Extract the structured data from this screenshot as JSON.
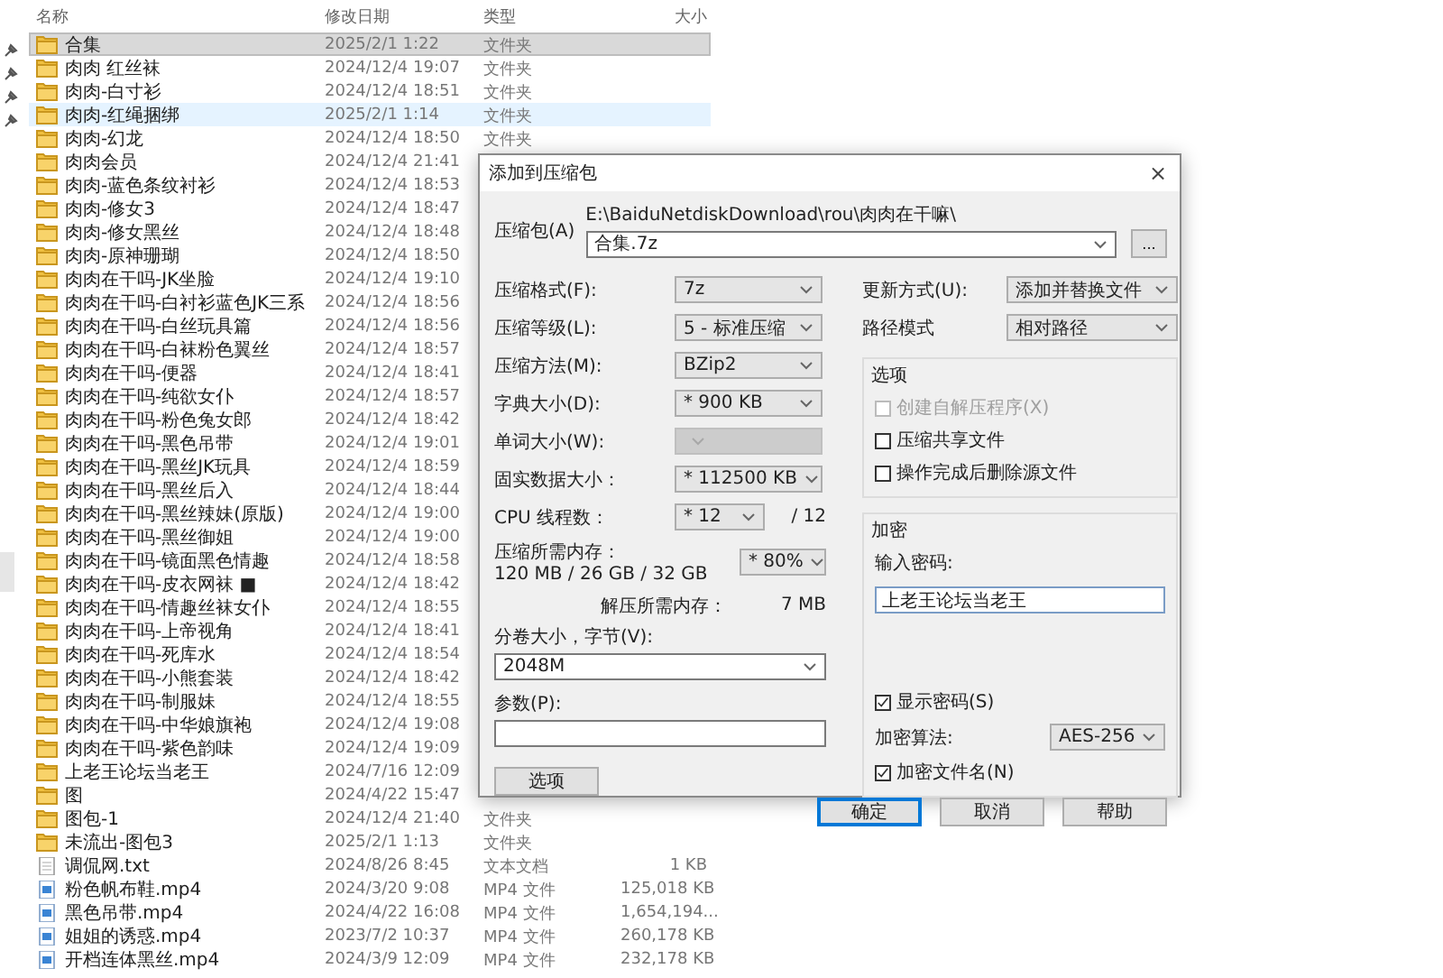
{
  "explorer": {
    "columns": [
      "名称",
      "修改日期",
      "类型",
      "大小"
    ],
    "items": [
      {
        "name": "合集",
        "kind": "folder",
        "modified": "2025/2/1 1:22",
        "type": "文件夹",
        "selected": true,
        "hovered": false
      },
      {
        "name": "肉肉 红丝袜",
        "kind": "folder",
        "modified": "2024/12/4 19:07",
        "type": "文件夹",
        "selected": false,
        "hovered": false
      },
      {
        "name": "肉肉-白寸衫",
        "kind": "folder",
        "modified": "2024/12/4 18:51",
        "type": "文件夹",
        "selected": false,
        "hovered": false
      },
      {
        "name": "肉肉-红绳捆绑",
        "kind": "folder",
        "modified": "2025/2/1 1:14",
        "type": "文件夹",
        "selected": false,
        "hovered": true
      },
      {
        "name": "肉肉-幻龙",
        "kind": "folder",
        "modified": "2024/12/4 18:50",
        "type": "文件夹",
        "selected": false,
        "hovered": false
      },
      {
        "name": "肉肉会员",
        "kind": "folder",
        "modified": "2024/12/4 21:41",
        "selected": false,
        "hovered": false
      },
      {
        "name": "肉肉-蓝色条纹衬衫",
        "kind": "folder",
        "modified": "2024/12/4 18:53",
        "selected": false,
        "hovered": false
      },
      {
        "name": "肉肉-修女3",
        "kind": "folder",
        "modified": "2024/12/4 18:47",
        "selected": false,
        "hovered": false
      },
      {
        "name": "肉肉-修女黑丝",
        "kind": "folder",
        "modified": "2024/12/4 18:48",
        "selected": false,
        "hovered": false
      },
      {
        "name": "肉肉-原神珊瑚",
        "kind": "folder",
        "modified": "2024/12/4 18:50",
        "selected": false,
        "hovered": false
      },
      {
        "name": "肉肉在干吗-JK坐脸",
        "kind": "folder",
        "modified": "2024/12/4 19:10",
        "selected": false,
        "hovered": false
      },
      {
        "name": "肉肉在干吗-白衬衫蓝色JK三系",
        "kind": "folder",
        "modified": "2024/12/4 18:56",
        "selected": false,
        "hovered": false
      },
      {
        "name": "肉肉在干吗-白丝玩具篇",
        "kind": "folder",
        "modified": "2024/12/4 18:56",
        "selected": false,
        "hovered": false
      },
      {
        "name": "肉肉在干吗-白袜粉色翼丝",
        "kind": "folder",
        "modified": "2024/12/4 18:57",
        "selected": false,
        "hovered": false
      },
      {
        "name": "肉肉在干吗-便器",
        "kind": "folder",
        "modified": "2024/12/4 18:41",
        "selected": false,
        "hovered": false
      },
      {
        "name": "肉肉在干吗-纯欲女仆",
        "kind": "folder",
        "modified": "2024/12/4 18:57",
        "selected": false,
        "hovered": false
      },
      {
        "name": "肉肉在干吗-粉色兔女郎",
        "kind": "folder",
        "modified": "2024/12/4 18:42",
        "selected": false,
        "hovered": false
      },
      {
        "name": "肉肉在干吗-黑色吊带",
        "kind": "folder",
        "modified": "2024/12/4 19:01",
        "selected": false,
        "hovered": false
      },
      {
        "name": "肉肉在干吗-黑丝JK玩具",
        "kind": "folder",
        "modified": "2024/12/4 18:59",
        "selected": false,
        "hovered": false
      },
      {
        "name": "肉肉在干吗-黑丝后入",
        "kind": "folder",
        "modified": "2024/12/4 18:44",
        "selected": false,
        "hovered": false
      },
      {
        "name": "肉肉在干吗-黑丝辣妹(原版)",
        "kind": "folder",
        "modified": "2024/12/4 19:00",
        "selected": false,
        "hovered": false
      },
      {
        "name": "肉肉在干吗-黑丝御姐",
        "kind": "folder",
        "modified": "2024/12/4 19:00",
        "selected": false,
        "hovered": false
      },
      {
        "name": "肉肉在干吗-镜面黑色情趣",
        "kind": "folder",
        "modified": "2024/12/4 18:58",
        "selected": false,
        "hovered": false
      },
      {
        "name": "肉肉在干吗-皮衣网袜 ■",
        "kind": "folder",
        "modified": "2024/12/4 18:42",
        "selected": false,
        "hovered": false
      },
      {
        "name": "肉肉在干吗-情趣丝袜女仆",
        "kind": "folder",
        "modified": "2024/12/4 18:55",
        "selected": false,
        "hovered": false
      },
      {
        "name": "肉肉在干吗-上帝视角",
        "kind": "folder",
        "modified": "2024/12/4 18:41",
        "selected": false,
        "hovered": false
      },
      {
        "name": "肉肉在干吗-死库水",
        "kind": "folder",
        "modified": "2024/12/4 18:54",
        "selected": false,
        "hovered": false
      },
      {
        "name": "肉肉在干吗-小熊套装",
        "kind": "folder",
        "modified": "2024/12/4 18:42",
        "selected": false,
        "hovered": false
      },
      {
        "name": "肉肉在干吗-制服妹",
        "kind": "folder",
        "modified": "2024/12/4 18:55",
        "selected": false,
        "hovered": false
      },
      {
        "name": "肉肉在干吗-中华娘旗袍",
        "kind": "folder",
        "modified": "2024/12/4 19:08",
        "selected": false,
        "hovered": false
      },
      {
        "name": "肉肉在干吗-紫色韵味",
        "kind": "folder",
        "modified": "2024/12/4 19:09",
        "selected": false,
        "hovered": false
      },
      {
        "name": "上老王论坛当老王",
        "kind": "folder",
        "modified": "2024/7/16 12:09",
        "selected": false,
        "hovered": false
      },
      {
        "name": "图",
        "kind": "folder",
        "modified": "2024/4/22 15:47",
        "selected": false,
        "hovered": false
      },
      {
        "name": "图包-1",
        "kind": "folder",
        "modified": "2024/12/4 21:40",
        "type": "文件夹",
        "selected": false,
        "hovered": false
      },
      {
        "name": "未流出-图包3",
        "kind": "folder",
        "modified": "2025/2/1 1:13",
        "type": "文件夹",
        "selected": false,
        "hovered": false
      },
      {
        "name": "调侃网.txt",
        "kind": "text",
        "modified": "2024/8/26 8:45",
        "type": "文本文档",
        "size": "1 KB",
        "selected": false,
        "hovered": false
      },
      {
        "name": "粉色帆布鞋.mp4",
        "kind": "video",
        "modified": "2024/3/20 9:08",
        "type": "MP4 文件",
        "size": "125,018 KB",
        "selected": false,
        "hovered": false
      },
      {
        "name": "黑色吊带.mp4",
        "kind": "video",
        "modified": "2024/4/22 16:08",
        "type": "MP4 文件",
        "size": "1,654,194...",
        "selected": false,
        "hovered": false
      },
      {
        "name": "姐姐的诱惑.mp4",
        "kind": "video",
        "modified": "2023/7/2 10:37",
        "type": "MP4 文件",
        "size": "260,178 KB",
        "selected": false,
        "hovered": false
      },
      {
        "name": "开档连体黑丝.mp4",
        "kind": "video",
        "modified": "2024/3/9 12:09",
        "type": "MP4 文件",
        "size": "232,178 KB",
        "selected": false,
        "hovered": false
      }
    ]
  },
  "dialog": {
    "title": "添加到压缩包",
    "close": "×",
    "archive": {
      "label": "压缩包(A)",
      "path": "E:\\BaiduNetdiskDownload\\rou\\肉肉在干嘛\\",
      "value": "合集.7z",
      "browse": "..."
    },
    "left": [
      {
        "kind": "select",
        "label": "压缩格式(F):",
        "value": "7z",
        "disabled": false
      },
      {
        "kind": "select",
        "label": "压缩等级(L):",
        "value": "5 - 标准压缩",
        "disabled": false
      },
      {
        "kind": "select",
        "label": "压缩方法(M):",
        "value": "BZip2",
        "disabled": false
      },
      {
        "kind": "select",
        "label": "字典大小(D):",
        "value": "* 900 KB",
        "disabled": false
      },
      {
        "kind": "select",
        "label": "单词大小(W):",
        "disabled": true
      },
      {
        "kind": "select",
        "label": "固实数据大小：",
        "value": "* 112500 KB",
        "disabled": false
      },
      {
        "kind": "threads",
        "label": "CPU 线程数：",
        "value": "* 12",
        "suffix": "/ 12",
        "disabled": false
      },
      {
        "kind": "memory",
        "label": "压缩所需内存：",
        "detail": "120 MB / 26 GB / 32 GB",
        "value": "* 80%"
      },
      {
        "kind": "info",
        "label": "解压所需内存：",
        "value": "7 MB"
      }
    ],
    "volume": {
      "label": "分卷大小，字节(V):",
      "value": "2048M"
    },
    "params": {
      "label": "参数(P):"
    },
    "options_button": "选项",
    "update": {
      "label": "更新方式(U):",
      "value": "添加并替换文件"
    },
    "path_mode": {
      "label": "路径模式",
      "value": "相对路径"
    },
    "options": {
      "title": "选项",
      "checks": [
        {
          "label": "创建自解压程序(X)",
          "checked": false,
          "disabled": true
        },
        {
          "label": "压缩共享文件",
          "checked": false,
          "disabled": false
        },
        {
          "label": "操作完成后删除源文件",
          "checked": false,
          "disabled": false
        }
      ]
    },
    "encryption": {
      "title": "加密",
      "password_label": "输入密码:",
      "password": "上老王论坛当老王",
      "checks_top": [
        {
          "label": "显示密码(S)",
          "checked": true,
          "disabled": false
        }
      ],
      "method": {
        "label": "加密算法:",
        "value": "AES-256"
      },
      "checks_bottom": [
        {
          "label": "加密文件名(N)",
          "checked": true,
          "disabled": false
        }
      ]
    },
    "buttons": [
      {
        "label": "确定",
        "default": true
      },
      {
        "label": "取消",
        "default": false
      },
      {
        "label": "帮助",
        "default": false
      }
    ]
  }
}
